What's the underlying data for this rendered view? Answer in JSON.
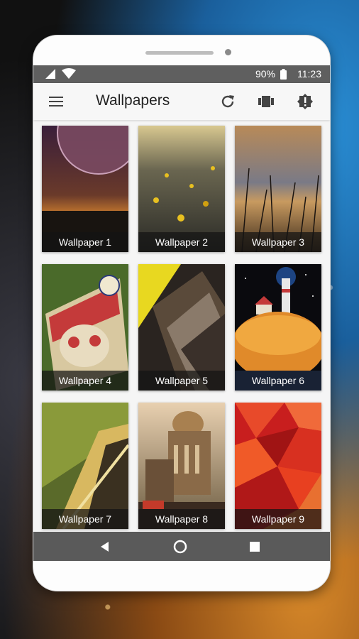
{
  "status": {
    "battery": "90%",
    "time": "11:23"
  },
  "appbar": {
    "title": "Wallpapers"
  },
  "icons": {
    "menu": "hamburger-menu-icon",
    "refresh": "refresh-icon",
    "apply": "wallpaper-carousel-icon",
    "report": "alert-badge-icon"
  },
  "wallpapers": [
    {
      "label": "Wallpaper 1"
    },
    {
      "label": "Wallpaper 2"
    },
    {
      "label": "Wallpaper 3"
    },
    {
      "label": "Wallpaper 4"
    },
    {
      "label": "Wallpaper 5"
    },
    {
      "label": "Wallpaper 6"
    },
    {
      "label": "Wallpaper 7"
    },
    {
      "label": "Wallpaper 8"
    },
    {
      "label": "Wallpaper 9"
    }
  ],
  "colors": {
    "statusbar": "#5f5f5f",
    "appbar": "#f7f7f7",
    "navbar": "#5a5a5a"
  }
}
